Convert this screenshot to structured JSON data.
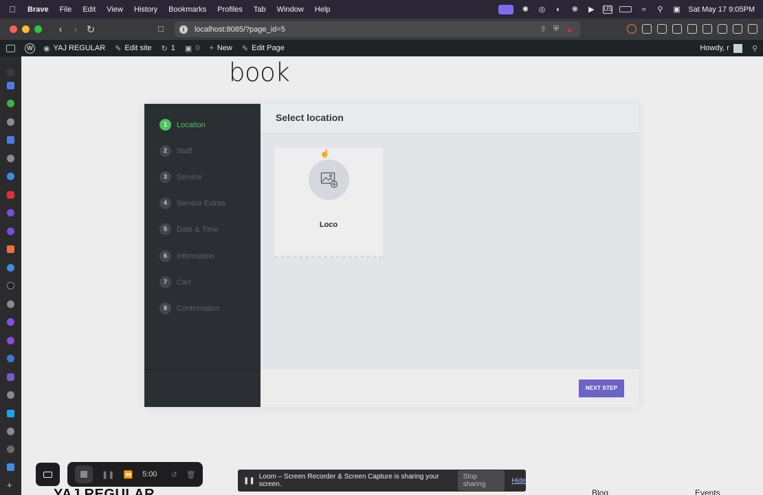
{
  "menubar": {
    "app": "Brave",
    "items": [
      "File",
      "Edit",
      "View",
      "History",
      "Bookmarks",
      "Profiles",
      "Tab",
      "Window",
      "Help"
    ],
    "input_source": "US",
    "clock": "Sat May 17  9:05PM"
  },
  "toolbar": {
    "url": "localhost:8085/?page_id=5"
  },
  "adminbar": {
    "site_name": "YAJ REGULAR",
    "edit_site": "Edit site",
    "updates_count": "1",
    "comments_count": "0",
    "new_label": "New",
    "edit_page": "Edit Page",
    "howdy": "Howdy, r"
  },
  "page": {
    "title": "book"
  },
  "booking": {
    "steps": [
      {
        "num": "1",
        "label": "Location"
      },
      {
        "num": "2",
        "label": "Staff"
      },
      {
        "num": "3",
        "label": "Service"
      },
      {
        "num": "4",
        "label": "Service Extras"
      },
      {
        "num": "5",
        "label": "Date & Time"
      },
      {
        "num": "6",
        "label": "Information"
      },
      {
        "num": "7",
        "label": "Cart"
      },
      {
        "num": "8",
        "label": "Confirmation"
      }
    ],
    "heading": "Select location",
    "location_card": {
      "name": "Loco"
    },
    "next_label": "NEXT STEP"
  },
  "footer": {
    "site_title": "YAJ REGULAR",
    "links": [
      "Blog",
      "Events"
    ]
  },
  "loom": {
    "timer": "5:00",
    "share_message": "Loom – Screen Recorder & Screen Capture is sharing your screen.",
    "stop_sharing": "Stop sharing",
    "hide": "Hide"
  }
}
